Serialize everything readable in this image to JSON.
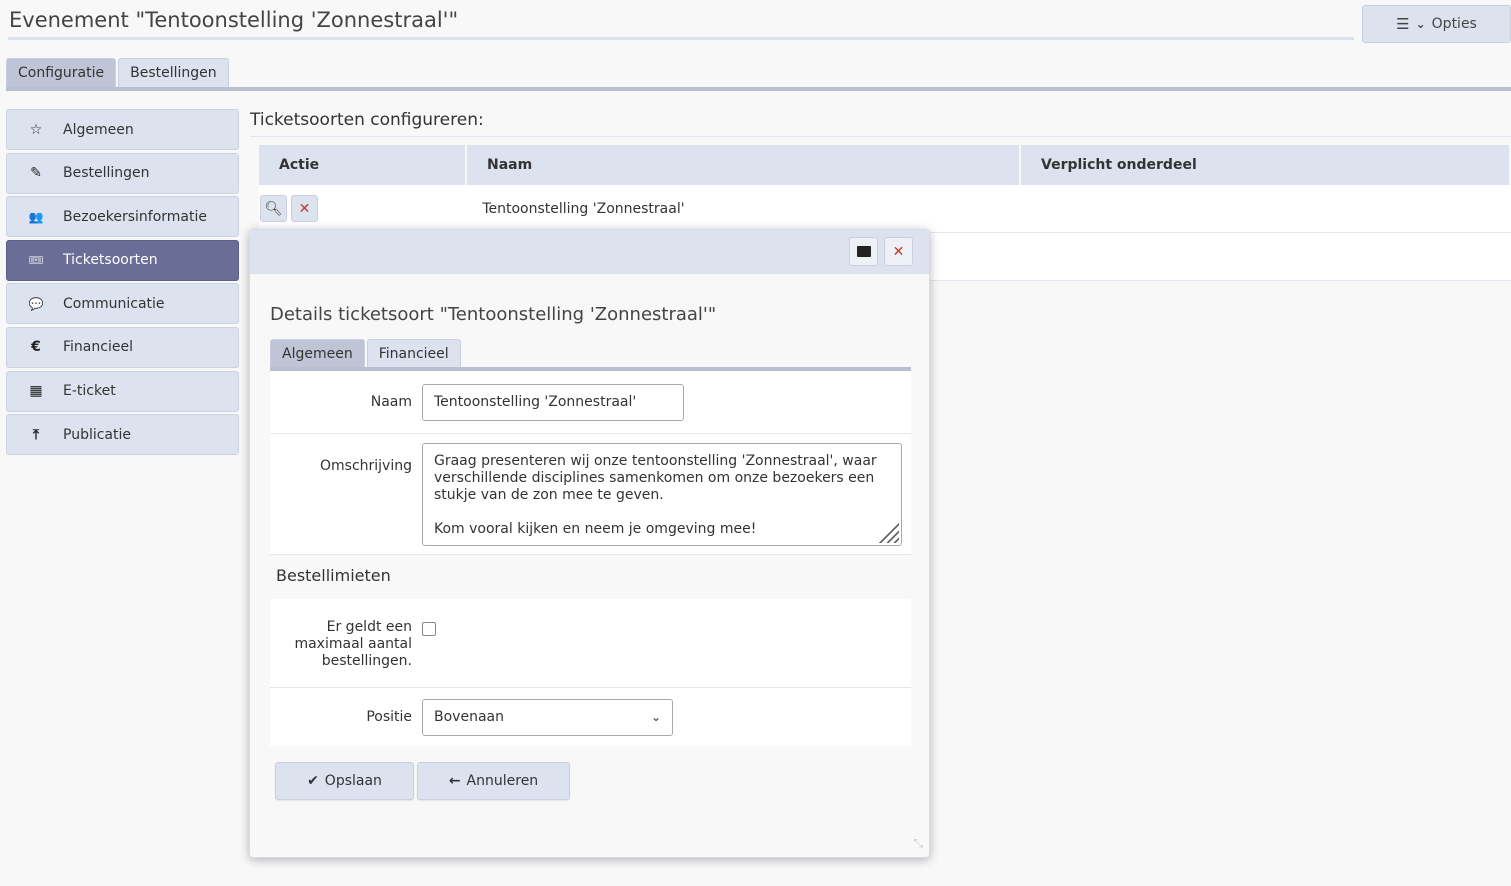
{
  "page": {
    "title": "Evenement \"Tentoonstelling 'Zonnestraal'\"",
    "options_label": "Opties",
    "options_icon": "sliders-icon",
    "options_chevron": "chevron-down-icon"
  },
  "top_tabs": [
    {
      "label": "Configuratie",
      "active": true
    },
    {
      "label": "Bestellingen",
      "active": false
    }
  ],
  "sidebar": {
    "items": [
      {
        "label": "Algemeen",
        "icon": "star-icon",
        "glyph": "☆"
      },
      {
        "label": "Bestellingen",
        "icon": "pencil-icon",
        "glyph": "✎"
      },
      {
        "label": "Bezoekersinformatie",
        "icon": "users-icon",
        "glyph": "👥"
      },
      {
        "label": "Ticketsoorten",
        "icon": "ticket-icon",
        "glyph": "🎟"
      },
      {
        "label": "Communicatie",
        "icon": "comments-icon",
        "glyph": "💬"
      },
      {
        "label": "Financieel",
        "icon": "euro-icon",
        "glyph": "€"
      },
      {
        "label": "E-ticket",
        "icon": "qrcode-icon",
        "glyph": "▦"
      },
      {
        "label": "Publicatie",
        "icon": "upload-icon",
        "glyph": "⤒"
      }
    ],
    "active_index": 3
  },
  "main": {
    "section_title": "Ticketsoorten configureren:",
    "columns": [
      "Actie",
      "Naam",
      "Verplicht onderdeel"
    ],
    "rows": [
      {
        "naam": "Tentoonstelling 'Zonnestraal'",
        "verplicht": ""
      },
      {
        "naam": "",
        "verplicht": ""
      }
    ]
  },
  "dialog": {
    "title": "Details ticketsoort \"Tentoonstelling 'Zonnestraal'\"",
    "tabs": [
      {
        "label": "Algemeen",
        "active": true
      },
      {
        "label": "Financieel",
        "active": false
      }
    ],
    "fields": {
      "naam_label": "Naam",
      "naam_value": "Tentoonstelling 'Zonnestraal'",
      "omschrijving_label": "Omschrijving",
      "omschrijving_line1": "Graag presenteren wij onze tentoonstelling 'Zonnestraal', waar",
      "omschrijving_line2": "verschillende disciplines samenkomen om onze bezoekers een",
      "omschrijving_line3": "stukje van de zon mee te geven.",
      "omschrijving_line4": "Kom vooral kijken en neem je omgeving mee!",
      "group_title": "Bestellimieten",
      "max_label_1": "Er geldt een",
      "max_label_2": "maximaal aantal",
      "max_label_3": "bestellingen.",
      "max_checked": false,
      "positie_label": "Positie",
      "positie_value": "Bovenaan"
    },
    "buttons": {
      "save": "Opslaan",
      "cancel": "Annuleren"
    }
  },
  "colors": {
    "accent_active": "#6a6d96",
    "tab_bg": "#dde2ef",
    "tab_active_bg": "#bfc4d6",
    "delete_red": "#c0392b"
  }
}
